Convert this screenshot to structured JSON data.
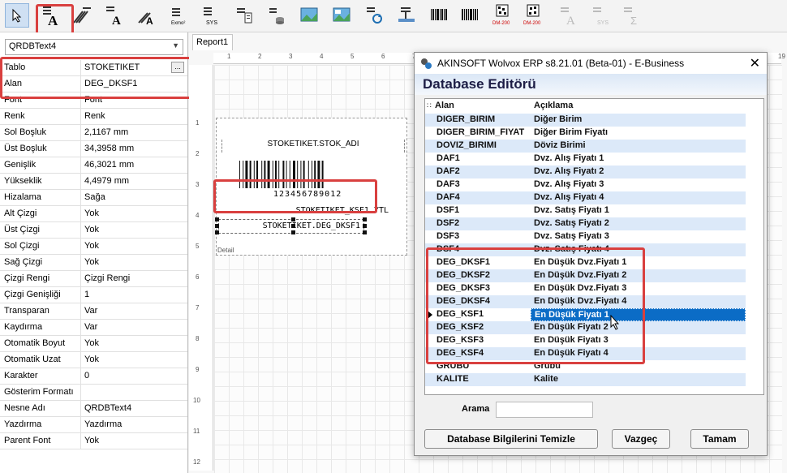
{
  "toolbar": {
    "items": [
      "pointer-tool",
      "text-tool",
      "barcode-text-tool",
      "rotated-text-tool",
      "rotated-barcode-tool",
      "formula-tool",
      "system-variable-tool",
      "data-text-tool",
      "image-tool",
      "picture-tool",
      "db-image-tool",
      "db-field-tool",
      "sum-tool",
      "barcode-1d-tool",
      "barcode-1d-b-tool",
      "datamatrix-tool",
      "datamatrix-b-tool",
      "disabled-text-tool",
      "disabled-sys-tool",
      "disabled-sum-tool"
    ],
    "sys_label": "SYS",
    "dm_label": "DM-200"
  },
  "left": {
    "combo_value": "QRDBText4",
    "props": [
      {
        "name": "Tablo",
        "value": "STOKETIKET"
      },
      {
        "name": "Alan",
        "value": "DEG_DKSF1"
      },
      {
        "name": "Font",
        "value": "Font"
      },
      {
        "name": "Renk",
        "value": "Renk"
      },
      {
        "name": "Sol Boşluk",
        "value": "2,1167 mm"
      },
      {
        "name": "Üst Boşluk",
        "value": "34,3958 mm"
      },
      {
        "name": "Genişlik",
        "value": "46,3021 mm"
      },
      {
        "name": "Yükseklik",
        "value": "4,4979 mm"
      },
      {
        "name": "Hizalama",
        "value": "Sağa"
      },
      {
        "name": "Alt Çizgi",
        "value": "Yok"
      },
      {
        "name": "Üst Çizgi",
        "value": "Yok"
      },
      {
        "name": "Sol Çizgi",
        "value": "Yok"
      },
      {
        "name": "Sağ Çizgi",
        "value": "Yok"
      },
      {
        "name": "Çizgi Rengi",
        "value": "Çizgi Rengi"
      },
      {
        "name": "Çizgi Genişliği",
        "value": "1"
      },
      {
        "name": "Transparan",
        "value": "Var"
      },
      {
        "name": "Kaydırma",
        "value": "Var"
      },
      {
        "name": "Otomatik Boyut",
        "value": "Yok"
      },
      {
        "name": "Otomatik Uzat",
        "value": "Yok"
      },
      {
        "name": "Karakter",
        "value": "0"
      },
      {
        "name": "Gösterim Formatı",
        "value": ""
      },
      {
        "name": "Nesne Adı",
        "value": "QRDBText4"
      },
      {
        "name": "Yazdırma",
        "value": "Yazdırma"
      },
      {
        "name": "Parent Font",
        "value": "Yok"
      }
    ]
  },
  "designer": {
    "tab": "Report1",
    "ruler_h": [
      "1",
      "2",
      "3",
      "4",
      "5",
      "6",
      "7",
      "19"
    ],
    "ruler_v": [
      "1",
      "2",
      "3",
      "4",
      "5",
      "6",
      "7",
      "8",
      "9",
      "10",
      "11",
      "12"
    ],
    "band_label": "Detail",
    "field_stok_adi": "STOKETIKET.STOK_ADI",
    "barcode_number": "123456789012",
    "field_ksf": "STOKETIKET_KSF1 YTL",
    "field_dksf": "STOKETIKET.DEG_DKSF1"
  },
  "dialog": {
    "title": "AKINSOFT Wolvox ERP s8.21.01 (Beta-01) - E-Business",
    "heading": "Database Editörü",
    "col1": "Alan",
    "col2": "Açıklama",
    "rows": [
      {
        "f": "DIGER_BIRIM",
        "d": "Diğer Birim"
      },
      {
        "f": "DIGER_BIRIM_FIYAT",
        "d": "Diğer Birim Fiyatı"
      },
      {
        "f": "DOVIZ_BIRIMI",
        "d": "Döviz Birimi"
      },
      {
        "f": "DAF1",
        "d": "Dvz. Alış Fiyatı 1"
      },
      {
        "f": "DAF2",
        "d": "Dvz. Alış Fiyatı 2"
      },
      {
        "f": "DAF3",
        "d": "Dvz. Alış Fiyatı 3"
      },
      {
        "f": "DAF4",
        "d": "Dvz. Alış Fiyatı 4"
      },
      {
        "f": "DSF1",
        "d": "Dvz. Satış Fiyatı 1"
      },
      {
        "f": "DSF2",
        "d": "Dvz. Satış Fiyatı 2"
      },
      {
        "f": "DSF3",
        "d": "Dvz. Satış Fiyatı 3"
      },
      {
        "f": "DSF4",
        "d": "Dvz. Satış Fiyatı 4"
      },
      {
        "f": "DEG_DKSF1",
        "d": "En Düşük Dvz.Fiyatı 1"
      },
      {
        "f": "DEG_DKSF2",
        "d": "En Düşük Dvz.Fiyatı 2"
      },
      {
        "f": "DEG_DKSF3",
        "d": "En Düşük Dvz.Fiyatı 3"
      },
      {
        "f": "DEG_DKSF4",
        "d": "En Düşük Dvz.Fiyatı 4"
      },
      {
        "f": "DEG_KSF1",
        "d": "En Düşük Fiyatı 1"
      },
      {
        "f": "DEG_KSF2",
        "d": "En Düşük Fiyatı 2"
      },
      {
        "f": "DEG_KSF3",
        "d": "En Düşük Fiyatı 3"
      },
      {
        "f": "DEG_KSF4",
        "d": "En Düşük Fiyatı 4"
      },
      {
        "f": "GRUBU",
        "d": "Grubu"
      },
      {
        "f": "KALITE",
        "d": "Kalite"
      }
    ],
    "selected_index": 15,
    "search_label": "Arama",
    "search_value": "",
    "btn_clear": "Database Bilgilerini Temizle",
    "btn_cancel": "Vazgeç",
    "btn_ok": "Tamam"
  },
  "colors": {
    "highlight": "#d9403f",
    "selection": "#0b6cc6",
    "alt_row": "#dce9f9"
  }
}
